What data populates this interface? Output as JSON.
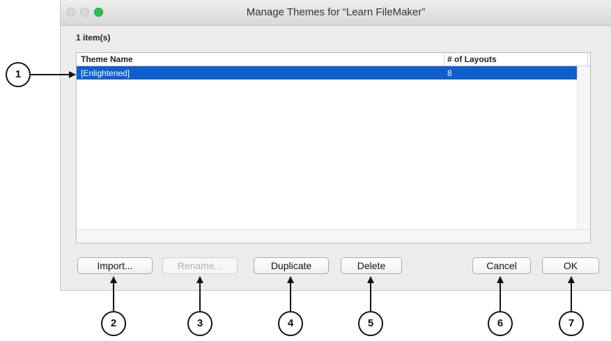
{
  "window": {
    "title": "Manage Themes for “Learn FileMaker”",
    "item_count": "1 item(s)"
  },
  "table": {
    "columns": [
      "Theme Name",
      "# of Layouts"
    ],
    "rows": [
      {
        "name": "[Enlightened]",
        "layouts": "8",
        "selected": true
      }
    ]
  },
  "buttons": {
    "import": "Import...",
    "rename": "Rename...",
    "duplicate": "Duplicate",
    "delete": "Delete",
    "cancel": "Cancel",
    "ok": "OK"
  },
  "callouts": [
    "1",
    "2",
    "3",
    "4",
    "5",
    "6",
    "7"
  ],
  "colors": {
    "selection": "#0f5fce",
    "zoom_button": "#2fc24a"
  }
}
